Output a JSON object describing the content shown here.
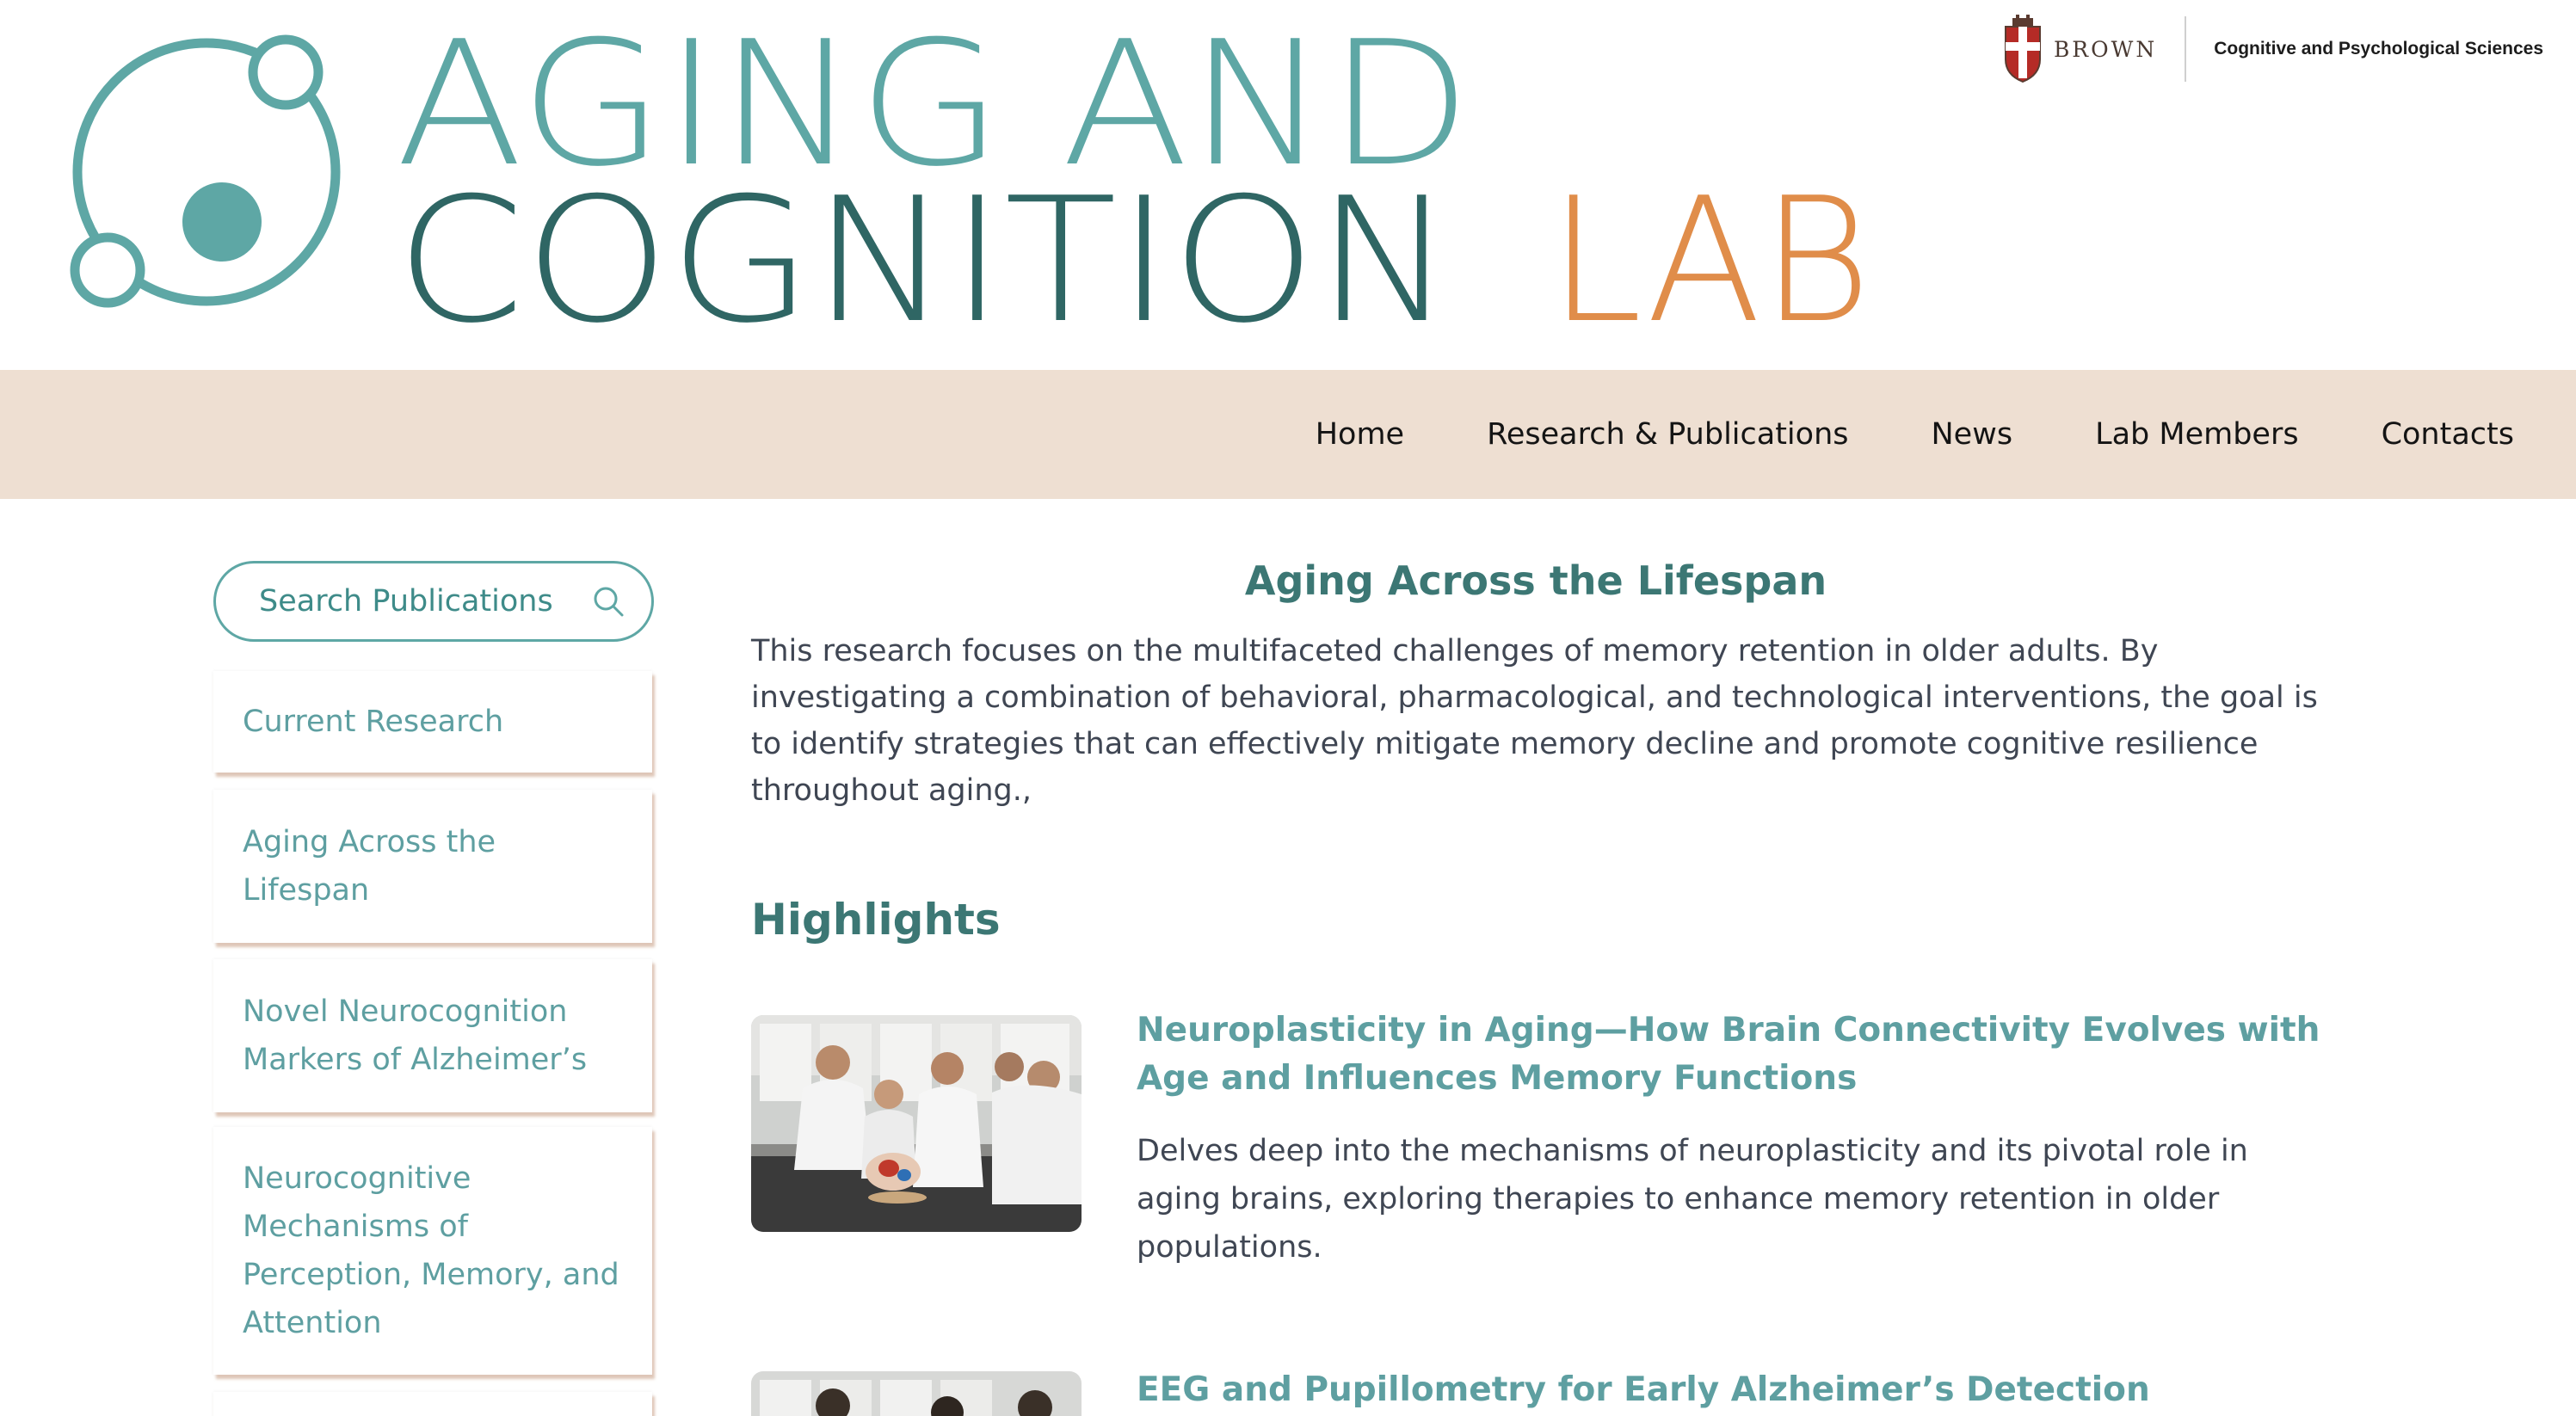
{
  "header": {
    "logo_line1": "AGING AND",
    "logo_line2": "COGNITION",
    "logo_line3": "LAB",
    "university": "BROWN",
    "department": "Cognitive and Psychological Sciences",
    "colors": {
      "teal": "#5ea7a5",
      "dark_teal": "#3c7774",
      "orange": "#e08d4a",
      "nav_bg": "#eedfd2"
    }
  },
  "nav": {
    "items": [
      {
        "label": "Home"
      },
      {
        "label": "Research & Publications"
      },
      {
        "label": "News"
      },
      {
        "label": "Lab Members"
      },
      {
        "label": "Contacts"
      }
    ]
  },
  "sidebar": {
    "search": {
      "label": "Search Publications",
      "icon": "search-icon"
    },
    "items": [
      {
        "label": "Current Research"
      },
      {
        "label": "Aging Across the Lifespan"
      },
      {
        "label": "Novel Neurocognition Markers of Alzheimer’s"
      },
      {
        "label": "Neurocognitive Mechanisms of Perception, Memory, and Attention"
      },
      {
        "label": ""
      }
    ]
  },
  "main": {
    "title": "Aging Across the Lifespan",
    "intro": "This research focuses on the multifaceted challenges of memory retention in older adults. By investigating a combination of behavioral, pharmacological, and technological interventions, the goal is to identify strategies that can effectively mitigate memory decline and promote cognitive resilience throughout aging.,",
    "highlights_heading": "Highlights",
    "highlights": [
      {
        "title": "Neuroplasticity in Aging—How Brain Connectivity Evolves with Age and Influences Memory Functions",
        "description": "Delves deep into the mechanisms of neuroplasticity and its pivotal role in aging brains, exploring therapies to enhance memory retention in older populations."
      },
      {
        "title": "EEG and Pupillometry for Early Alzheimer’s Detection",
        "description": ""
      }
    ]
  }
}
